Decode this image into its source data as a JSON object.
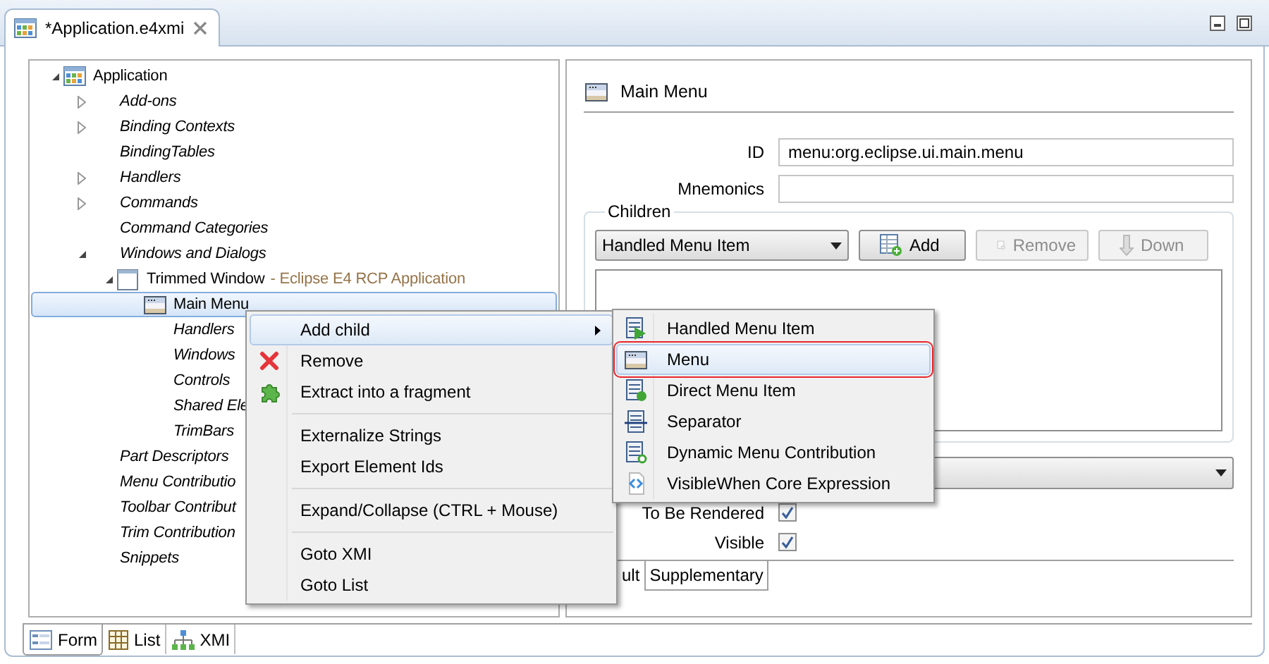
{
  "editor_tab": {
    "title": "*Application.e4xmi",
    "selected": true
  },
  "tree": [
    {
      "label": "Application",
      "kind": "application",
      "expanded": true,
      "selected": false,
      "children": [
        {
          "label": "Add-ons",
          "kind": "folder",
          "expanded": false,
          "selected": false
        },
        {
          "label": "Binding Contexts",
          "kind": "folder",
          "expanded": false,
          "selected": false
        },
        {
          "label": "BindingTables",
          "kind": "folder",
          "selected": false
        },
        {
          "label": "Handlers",
          "kind": "folder",
          "expanded": false,
          "selected": false
        },
        {
          "label": "Commands",
          "kind": "folder",
          "expanded": false,
          "selected": false
        },
        {
          "label": "Command Categories",
          "kind": "folder",
          "selected": false
        },
        {
          "label": "Windows and Dialogs",
          "kind": "folder",
          "expanded": true,
          "selected": false,
          "children": [
            {
              "label": "Trimmed Window",
              "detail": "- Eclipse E4 RCP Application",
              "kind": "window",
              "expanded": true,
              "selected": false,
              "children": [
                {
                  "label": "Main Menu",
                  "kind": "menu",
                  "selected": true
                },
                {
                  "label": "Handlers",
                  "kind": "folder",
                  "selected": false
                },
                {
                  "label": "Windows",
                  "kind": "folder",
                  "selected": false
                },
                {
                  "label": "Controls",
                  "kind": "folder",
                  "selected": false
                },
                {
                  "label": "Shared Ele",
                  "kind": "folder",
                  "selected": false
                },
                {
                  "label": "TrimBars",
                  "kind": "folder",
                  "selected": false
                }
              ]
            }
          ]
        },
        {
          "label": "Part Descriptors",
          "kind": "folder",
          "selected": false
        },
        {
          "label": "Menu Contributio",
          "kind": "folder",
          "selected": false
        },
        {
          "label": "Toolbar Contribut",
          "kind": "folder",
          "selected": false
        },
        {
          "label": "Trim Contribution",
          "kind": "folder",
          "selected": false
        },
        {
          "label": "Snippets",
          "kind": "folder",
          "selected": false
        }
      ]
    }
  ],
  "details": {
    "title": "Main Menu",
    "fields": [
      {
        "label": "ID",
        "value": "menu:org.eclipse.ui.main.menu"
      },
      {
        "label": "Mnemonics"
      }
    ],
    "children_group": {
      "legend": "Children",
      "type": "Handled Menu Item",
      "buttons": [
        {
          "label": "Add",
          "disabled": false
        },
        {
          "label": "Remove",
          "disabled": true
        },
        {
          "label": "Down",
          "disabled": true
        }
      ]
    },
    "checkboxes": [
      {
        "label": "To Be Rendered",
        "checked": true
      },
      {
        "label": "Visible",
        "checked": true
      }
    ],
    "tabs": [
      {
        "label": "ult",
        "selected": false
      },
      {
        "label": "Supplementary",
        "selected": true
      }
    ]
  },
  "bottom_tabs": [
    {
      "label": "Form",
      "selected": true
    },
    {
      "label": "List",
      "selected": false
    },
    {
      "label": "XMI",
      "selected": false
    }
  ],
  "context_menu": [
    {
      "kind": "item",
      "label": "Add child",
      "selected": true,
      "submenu": true
    },
    {
      "kind": "item",
      "label": "Remove",
      "selected": false,
      "submenu": false
    },
    {
      "kind": "item",
      "label": "Extract into a fragment",
      "selected": false,
      "submenu": false
    },
    {
      "kind": "separator"
    },
    {
      "kind": "item",
      "label": "Externalize Strings",
      "selected": false,
      "submenu": false
    },
    {
      "kind": "item",
      "label": "Export Element Ids",
      "selected": false,
      "submenu": false
    },
    {
      "kind": "separator"
    },
    {
      "kind": "item",
      "label": "Expand/Collapse (CTRL + Mouse)",
      "selected": false,
      "submenu": false
    },
    {
      "kind": "separator"
    },
    {
      "kind": "item",
      "label": "Goto XMI",
      "selected": false,
      "submenu": false
    },
    {
      "kind": "item",
      "label": "Goto List",
      "selected": false,
      "submenu": false
    }
  ],
  "submenu": [
    {
      "label": "Handled Menu Item",
      "selected": false,
      "marked": false
    },
    {
      "label": "Menu",
      "selected": true,
      "marked": true
    },
    {
      "label": "Direct Menu Item",
      "selected": false,
      "marked": false
    },
    {
      "label": "Separator",
      "selected": false,
      "marked": false
    },
    {
      "label": "Dynamic Menu Contribution",
      "selected": false,
      "marked": false
    },
    {
      "label": "VisibleWhen Core Expression",
      "selected": false,
      "marked": false
    }
  ]
}
